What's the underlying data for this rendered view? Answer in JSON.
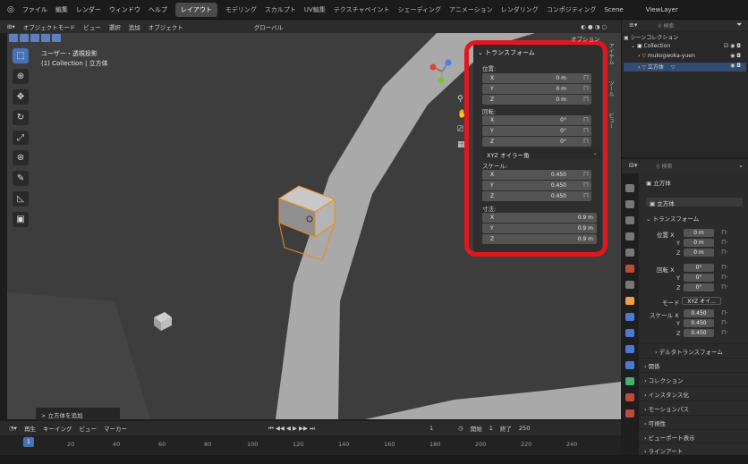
{
  "menu": {
    "app_icon": "blender-icon",
    "items": [
      "ファイル",
      "編集",
      "レンダー",
      "ウィンドウ",
      "ヘルプ"
    ],
    "workspaces": [
      "レイアウト",
      "モデリング",
      "スカルプト",
      "UV編集",
      "テクスチャペイント",
      "シェーディング",
      "アニメーション",
      "レンダリング",
      "コンポジティング"
    ],
    "active_workspace": "レイアウト",
    "scene": "Scene",
    "view_layer": "ViewLayer"
  },
  "viewport_header": {
    "mode": "オブジェクトモード",
    "menus": [
      "ビュー",
      "選択",
      "追加",
      "オブジェクト"
    ],
    "orientation": "グローバル",
    "options": "オプション"
  },
  "viewport_info": {
    "view": "ユーザー・透視投影",
    "collection": "(1) Collection | 立方体"
  },
  "npanel": {
    "title": "トランスフォーム",
    "location_label": "位置:",
    "location": [
      {
        "axis": "X",
        "value": "0 m"
      },
      {
        "axis": "Y",
        "value": "0 m"
      },
      {
        "axis": "Z",
        "value": "0 m"
      }
    ],
    "rotation_label": "回転:",
    "rotation": [
      {
        "axis": "X",
        "value": "0°"
      },
      {
        "axis": "Y",
        "value": "0°"
      },
      {
        "axis": "Z",
        "value": "0°"
      }
    ],
    "rotation_mode": "XYZ オイラー角",
    "scale_label": "スケール:",
    "scale": [
      {
        "axis": "X",
        "value": "0.450"
      },
      {
        "axis": "Y",
        "value": "0.450"
      },
      {
        "axis": "Z",
        "value": "0.450"
      }
    ],
    "dimensions_label": "寸法:",
    "dimensions": [
      {
        "axis": "X",
        "value": "0.9 m"
      },
      {
        "axis": "Y",
        "value": "0.9 m"
      },
      {
        "axis": "Z",
        "value": "0.9 m"
      }
    ],
    "tabs": [
      "アイテム",
      "ツール",
      "ビュー"
    ]
  },
  "highlight_color": "#e5161b",
  "accent_color": "#4772b3",
  "toast": "> 立方体を追加",
  "timeline": {
    "menus": [
      "再生",
      "キーイング",
      "ビュー",
      "マーカー"
    ],
    "current_frame": "1",
    "start_label": "開始",
    "start": "1",
    "end_label": "終了",
    "end": "250",
    "ticks": [
      "20",
      "40",
      "60",
      "80",
      "100",
      "120",
      "140",
      "160",
      "180",
      "200",
      "220",
      "240"
    ]
  },
  "outliner": {
    "search_placeholder": "検索",
    "root": "シーンコレクション",
    "items": [
      {
        "name": "Collection",
        "type": "collection"
      },
      {
        "name": "mukogwoka-yuen",
        "type": "mesh"
      },
      {
        "name": "立方体",
        "type": "mesh",
        "selected": true
      }
    ]
  },
  "properties": {
    "search_placeholder": "検索",
    "object_name": "立方体",
    "object_field": "立方体",
    "transform_header": "トランスフォーム",
    "location_label": "位置 X",
    "location": [
      "0 m",
      "0 m",
      "0 m"
    ],
    "rotation_label": "回転 X",
    "rotation": [
      "0°",
      "0°",
      "0°"
    ],
    "mode_label": "モード",
    "mode_value": "XYZ オイ...",
    "scale_label": "スケール X",
    "scale": [
      "0.450",
      "0.450",
      "0.450"
    ],
    "axis_y": "Y",
    "axis_z": "Z",
    "sections": [
      "デルタトランスフォーム",
      "関係",
      "コレクション",
      "インスタンス化",
      "モーションパス",
      "可視性",
      "ビューポート表示",
      "ラインアート"
    ]
  }
}
